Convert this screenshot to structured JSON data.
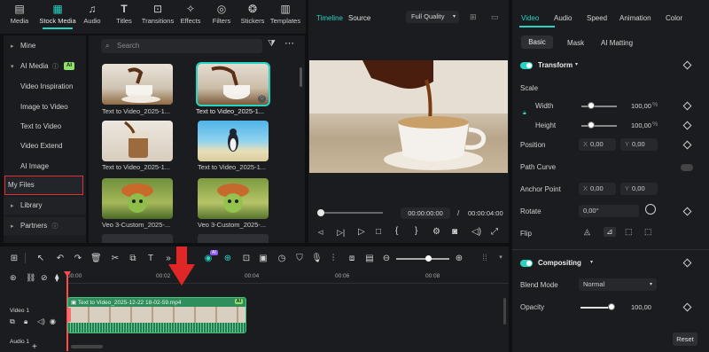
{
  "toolbar": {
    "items": [
      {
        "label": "Media",
        "icon": "media-icon"
      },
      {
        "label": "Stock Media",
        "icon": "stock-media-icon"
      },
      {
        "label": "Audio",
        "icon": "audio-icon"
      },
      {
        "label": "Titles",
        "icon": "titles-icon"
      },
      {
        "label": "Transitions",
        "icon": "transitions-icon"
      },
      {
        "label": "Effects",
        "icon": "effects-icon"
      },
      {
        "label": "Filters",
        "icon": "filters-icon"
      },
      {
        "label": "Stickers",
        "icon": "stickers-icon"
      },
      {
        "label": "Templates",
        "icon": "templates-icon"
      }
    ],
    "active": "Stock Media"
  },
  "sidebar": {
    "mine": "Mine",
    "ai_media": "AI Media",
    "ai_badge": "AI",
    "items": [
      "Video Inspiration",
      "Image to Video",
      "Text to Video",
      "Video Extend",
      "AI Image",
      "My Files"
    ],
    "library": "Library",
    "partners": "Partners"
  },
  "browser": {
    "search_placeholder": "Search",
    "thumbnails": [
      {
        "caption": "Text to Video_2025-1...",
        "selected": false
      },
      {
        "caption": "Text to Video_2025-1...",
        "selected": true
      },
      {
        "caption": "Text to Video_2025-1...",
        "selected": false
      },
      {
        "caption": "Text to Video_2025-1...",
        "selected": false
      },
      {
        "caption": "Veo 3-Custom_2025-...",
        "selected": false
      },
      {
        "caption": "Veo 3-Custom_2025-...",
        "selected": false
      }
    ]
  },
  "player": {
    "tab_timeline": "Timeline",
    "tab_source": "Source",
    "quality": "Full Quality",
    "time_current": "00:00:00:00",
    "time_sep": "/",
    "time_total": "00:00:04:00"
  },
  "inspector": {
    "tabs": [
      "Video",
      "Audio",
      "Speed",
      "Animation",
      "Color"
    ],
    "active_tab": "Video",
    "subtabs": [
      "Basic",
      "Mask",
      "AI Matting"
    ],
    "transform": "Transform",
    "scale": "Scale",
    "width_label": "Width",
    "width_value": "100,00",
    "height_label": "Height",
    "height_value": "100,00",
    "pct": "%",
    "position": "Position",
    "pos_x_label": "X",
    "pos_x": "0,00",
    "pos_y_label": "Y",
    "pos_y": "0,00",
    "path_curve": "Path Curve",
    "anchor_point": "Anchor Point",
    "anchor_x": "0,00",
    "anchor_y": "0,00",
    "rotate": "Rotate",
    "rotate_value": "0,00°",
    "flip": "Flip",
    "compositing": "Compositing",
    "blend_mode": "Blend Mode",
    "blend_value": "Normal",
    "opacity": "Opacity",
    "opacity_value": "100,00",
    "reset": "Reset"
  },
  "timeline": {
    "ruler": [
      "00:00",
      "00:02",
      "00:04",
      "00:06",
      "00:08"
    ],
    "clip_name": "Text to Video_2025-12-22 18-02-59.mp4",
    "clip_ai_badge": "AI",
    "track_video": "Video 1",
    "track_audio": "Audio 1",
    "ai_pill": "AI"
  },
  "colors": {
    "accent": "#27d3c3",
    "highlight_red": "#e23030",
    "clip_green": "#2f8f5c",
    "ai_badge": "#8fe06a"
  }
}
